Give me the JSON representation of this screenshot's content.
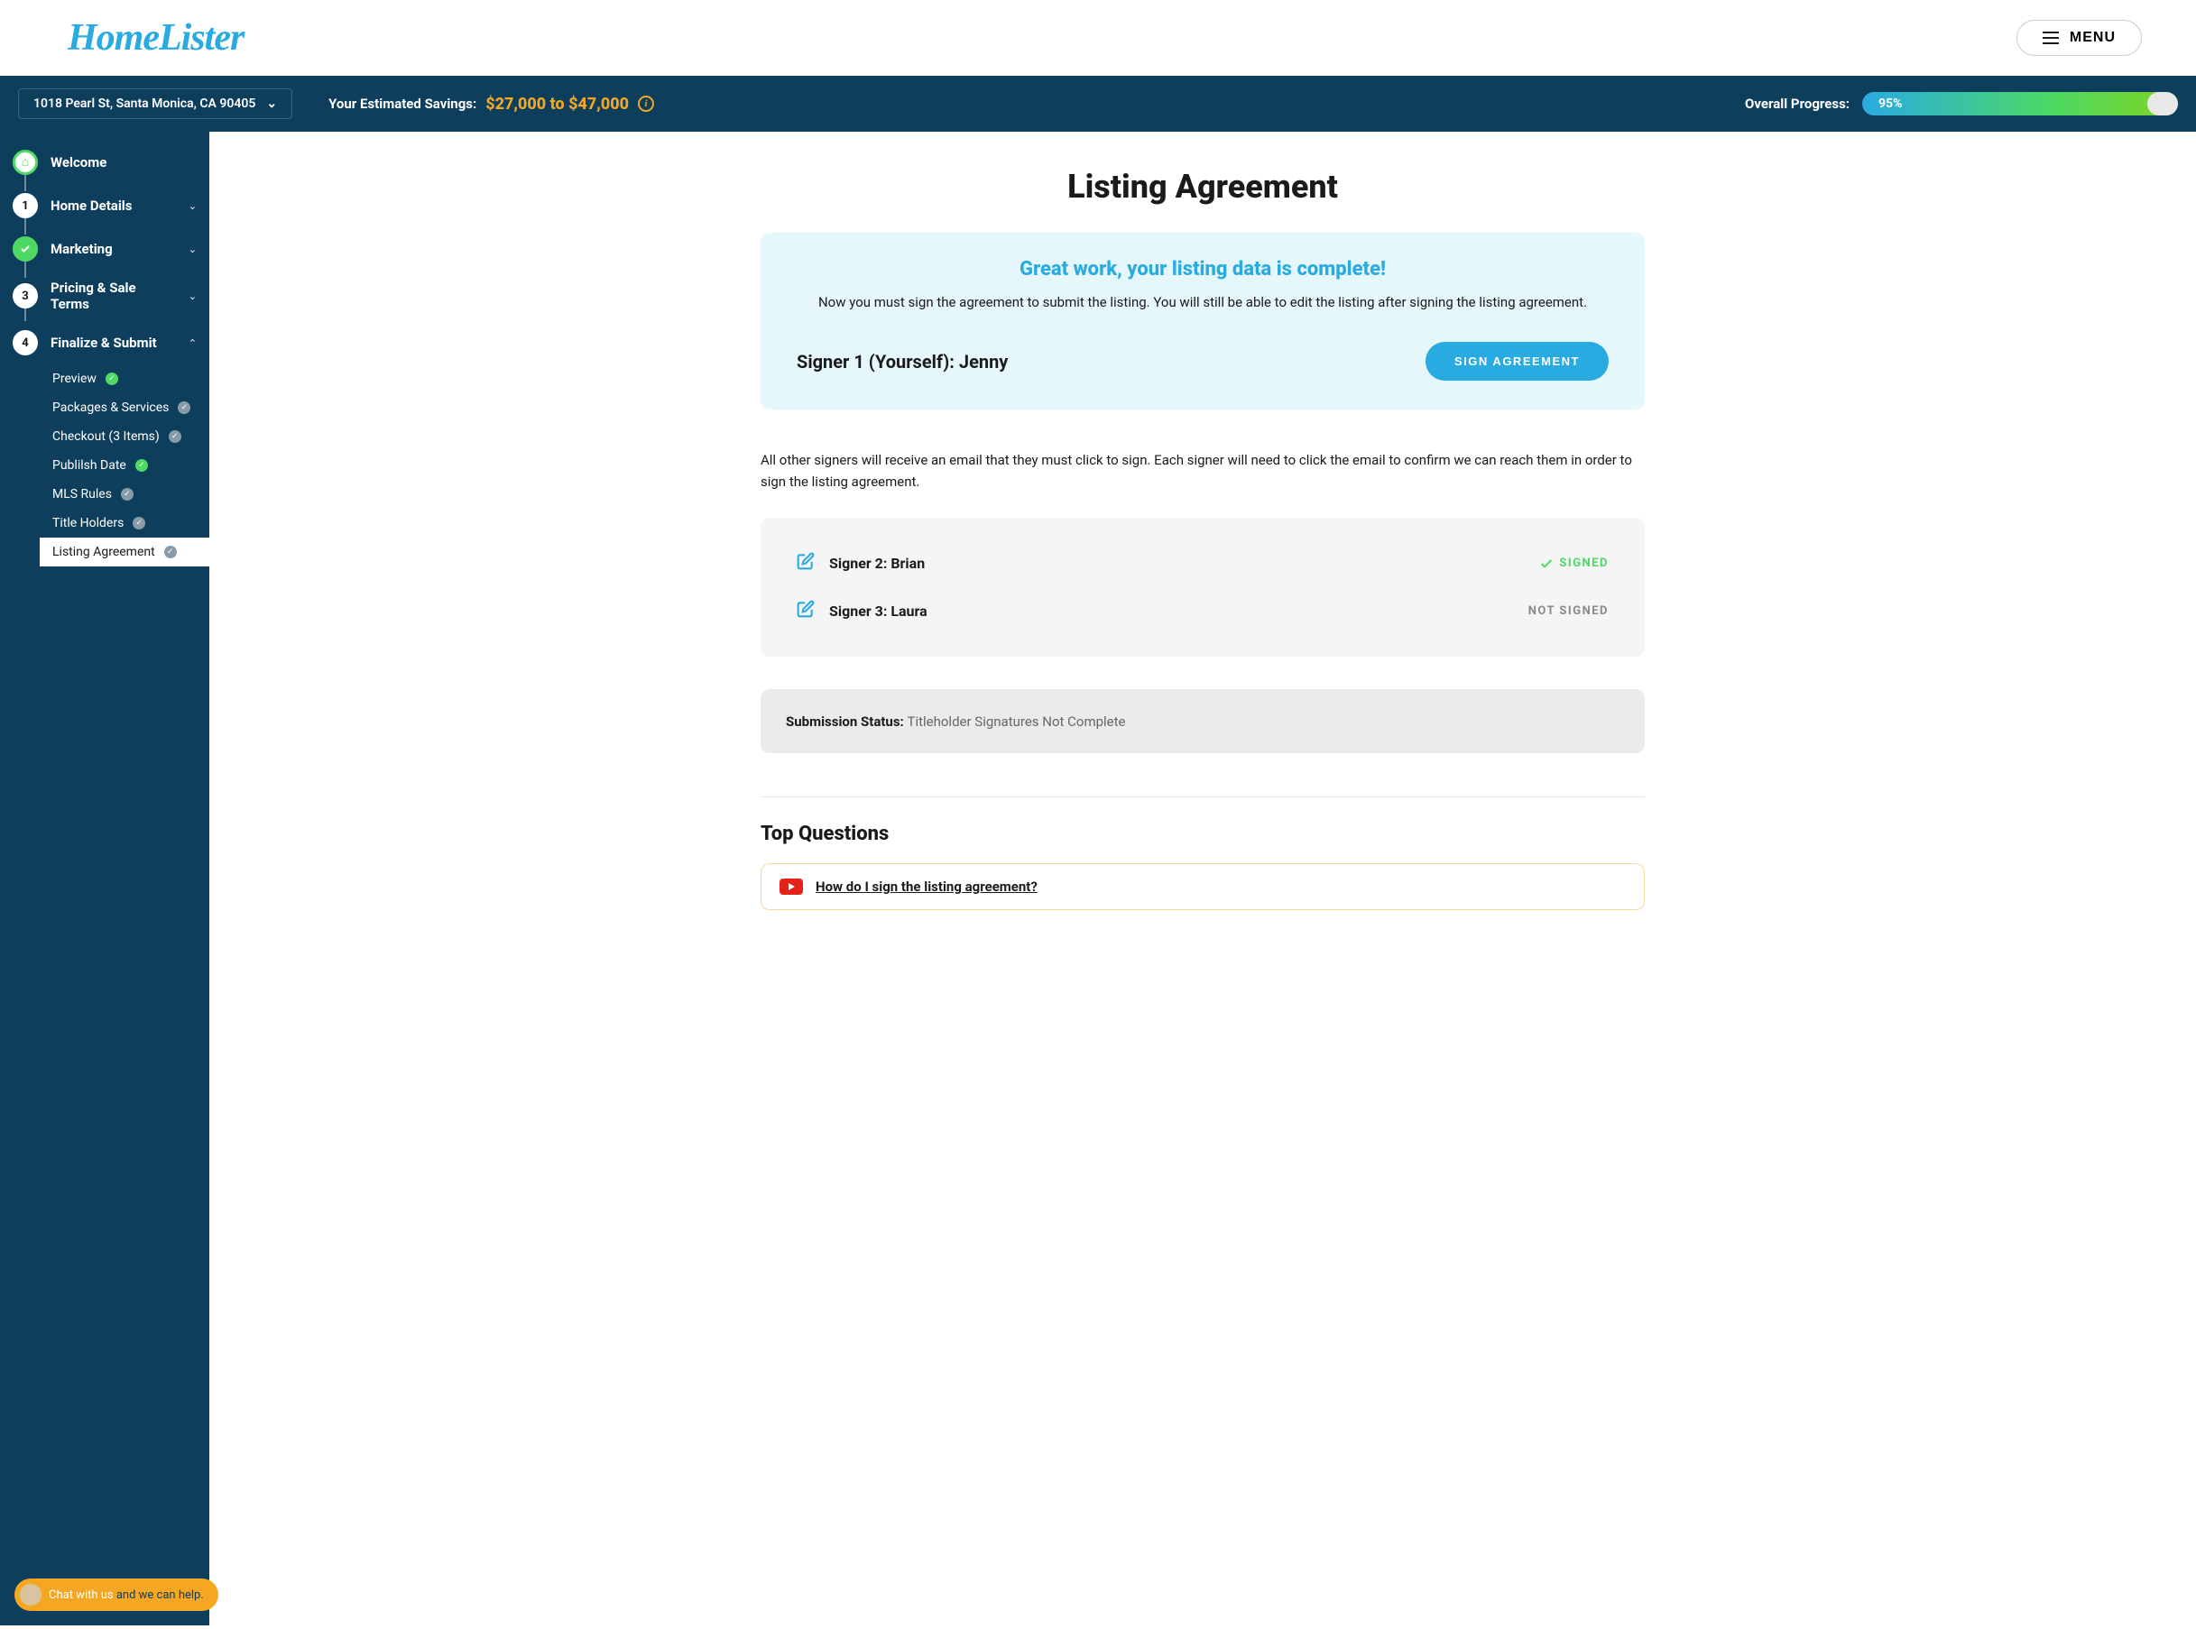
{
  "header": {
    "logo": "HomeLister",
    "menu": "MENU"
  },
  "infobar": {
    "address": "1018 Pearl St, Santa Monica, CA 90405",
    "savings_label": "Your Estimated Savings:",
    "savings_value": "$27,000 to $47,000",
    "progress_label": "Overall Progress:",
    "progress_value": "95%"
  },
  "sidebar": {
    "items": [
      {
        "label": "Welcome"
      },
      {
        "label": "Home Details",
        "num": "1"
      },
      {
        "label": "Marketing"
      },
      {
        "label": "Pricing & Sale Terms",
        "num": "3"
      },
      {
        "label": "Finalize & Submit",
        "num": "4"
      }
    ],
    "subitems": [
      {
        "label": "Preview",
        "status": "done"
      },
      {
        "label": "Packages & Services",
        "status": "gray"
      },
      {
        "label": "Checkout (3 Items)",
        "status": "gray"
      },
      {
        "label": "Publilsh Date",
        "status": "done"
      },
      {
        "label": "MLS Rules",
        "status": "gray"
      },
      {
        "label": "Title Holders",
        "status": "gray"
      },
      {
        "label": "Listing Agreement",
        "status": "gray"
      }
    ]
  },
  "chat": {
    "text1": "Chat with us",
    "text2": " and we can help."
  },
  "page": {
    "title": "Listing Agreement",
    "hero_title": "Great work, your listing data is complete!",
    "hero_sub": "Now you must sign the agreement to submit the listing. You will still be able to edit the listing after signing the listing agreement.",
    "signer1": "Signer 1 (Yourself): Jenny",
    "sign_btn": "SIGN AGREEMENT",
    "body": "All other signers will receive an email that they must click to sign. Each signer will need to click the email to confirm we can reach them in order to sign the listing agreement.",
    "signers": [
      {
        "name": "Signer 2: Brian",
        "signed": true,
        "status": "SIGNED"
      },
      {
        "name": "Signer 3: Laura",
        "signed": false,
        "status": "NOT SIGNED"
      }
    ],
    "status_label": "Submission Status: ",
    "status_value": "Titleholder Signatures Not Complete",
    "faq_title": "Top Questions",
    "faq_item": "How do I sign the listing agreement?"
  }
}
